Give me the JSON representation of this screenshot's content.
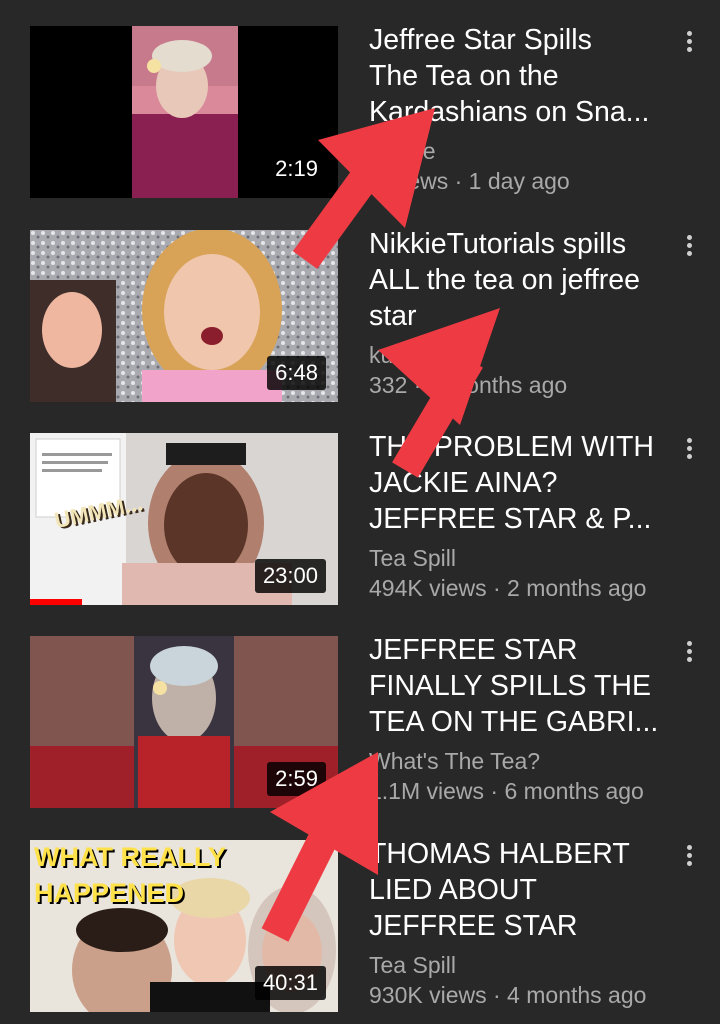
{
  "videos": [
    {
      "title": "Jeffree Star Spills\nThe Tea on the\nKardashians on Sna...",
      "channel": "Shade",
      "meta": "K views · 1 day ago",
      "duration": "2:19"
    },
    {
      "title": "NikkieTutorials spills\nALL the tea on jeffree\nstar",
      "channel": "kucki t",
      "meta": "332 · 6 months ago",
      "duration": "6:48"
    },
    {
      "title": "THE PROBLEM WITH\nJACKIE AINA?\nJEFFREE STAR & P...",
      "channel": "Tea Spill",
      "meta": "494K views · 2 months ago",
      "duration": "23:00",
      "progress": 0.17,
      "tweet_text": "UMMM..."
    },
    {
      "title": "JEFFREE STAR\nFINALLY SPILLS THE\nTEA ON THE GABRI...",
      "channel": "What's The Tea?",
      "meta": "1.1M views · 6 months ago",
      "duration": "2:59"
    },
    {
      "title": "THOMAS HALBERT\nLIED ABOUT\nJEFFREE STAR",
      "channel": "Tea Spill",
      "meta": "930K views · 4 months ago",
      "duration": "40:31",
      "thumb_text_1": "WHAT REALLY",
      "thumb_text_2": "HAPPENED"
    }
  ],
  "icons": {
    "menu": "more-vert-icon"
  },
  "colors": {
    "background": "#282828",
    "arrow": "#ee3b43",
    "progress": "#ff0000",
    "secondary_text": "#a9a9a9"
  }
}
